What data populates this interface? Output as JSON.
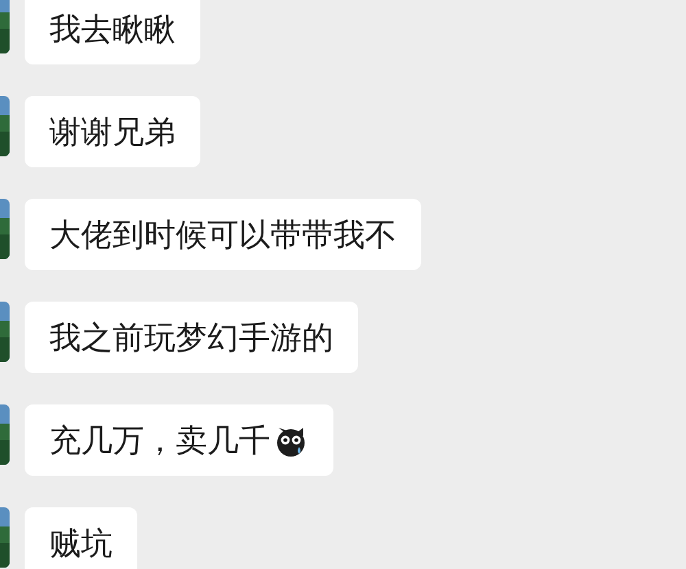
{
  "messages": [
    {
      "kind": "text",
      "text": "我去瞅瞅"
    },
    {
      "kind": "text",
      "text": "谢谢兄弟"
    },
    {
      "kind": "text",
      "text": "大佬到时候可以带带我不"
    },
    {
      "kind": "text",
      "text": "我之前玩梦幻手游的"
    },
    {
      "kind": "sticker",
      "text": "充几万，卖几千"
    },
    {
      "kind": "text",
      "text": "贼坑"
    }
  ]
}
